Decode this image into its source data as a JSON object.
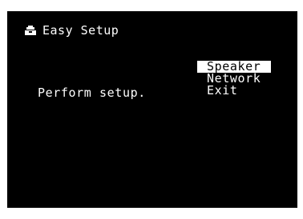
{
  "header": {
    "icon": "toolbox-icon",
    "title": "Easy Setup"
  },
  "message": "Perform setup.",
  "menu": {
    "items": [
      {
        "label": "Speaker",
        "selected": true
      },
      {
        "label": "Network",
        "selected": false
      },
      {
        "label": "Exit",
        "selected": false
      }
    ]
  },
  "colors": {
    "background": "#000000",
    "text": "#ffffff",
    "highlight": "#ffffff",
    "highlight_text": "#000000"
  }
}
